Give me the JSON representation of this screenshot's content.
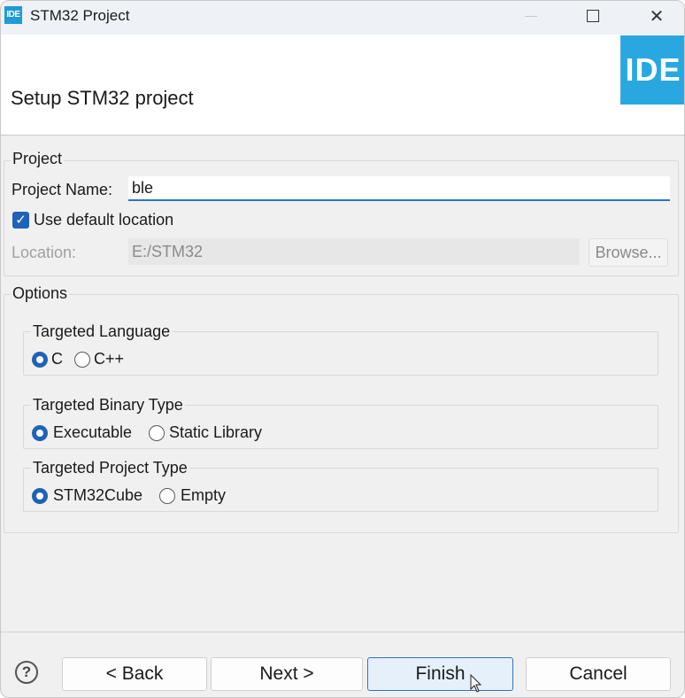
{
  "window": {
    "title": "STM32 Project",
    "app_icon_text": "IDE",
    "minimize_icon": "minimize-icon",
    "maximize_icon": "maximize-icon",
    "close_glyph": "✕"
  },
  "banner": {
    "title": "Setup STM32 project",
    "logo_text": "IDE",
    "logo_color": "#29a8e0"
  },
  "project": {
    "group_label": "Project",
    "name_label": "Project Name:",
    "name_value": "ble",
    "use_default_label": "Use default location",
    "use_default_checked": true,
    "location_label": "Location:",
    "location_value": "E:/STM32",
    "browse_label": "Browse..."
  },
  "options": {
    "group_label": "Options",
    "language": {
      "label": "Targeted Language",
      "options": [
        "C",
        "C++"
      ],
      "selected": "C"
    },
    "binary": {
      "label": "Targeted Binary Type",
      "options": [
        "Executable",
        "Static Library"
      ],
      "selected": "Executable"
    },
    "project_type": {
      "label": "Targeted Project Type",
      "options": [
        "STM32Cube",
        "Empty"
      ],
      "selected": "STM32Cube"
    }
  },
  "footer": {
    "help_glyph": "?",
    "back_label": "< Back",
    "next_label": "Next >",
    "finish_label": "Finish",
    "cancel_label": "Cancel"
  },
  "colors": {
    "accent": "#1f63b8",
    "focus_border": "#2b74c7",
    "background": "#f0f0f0"
  }
}
